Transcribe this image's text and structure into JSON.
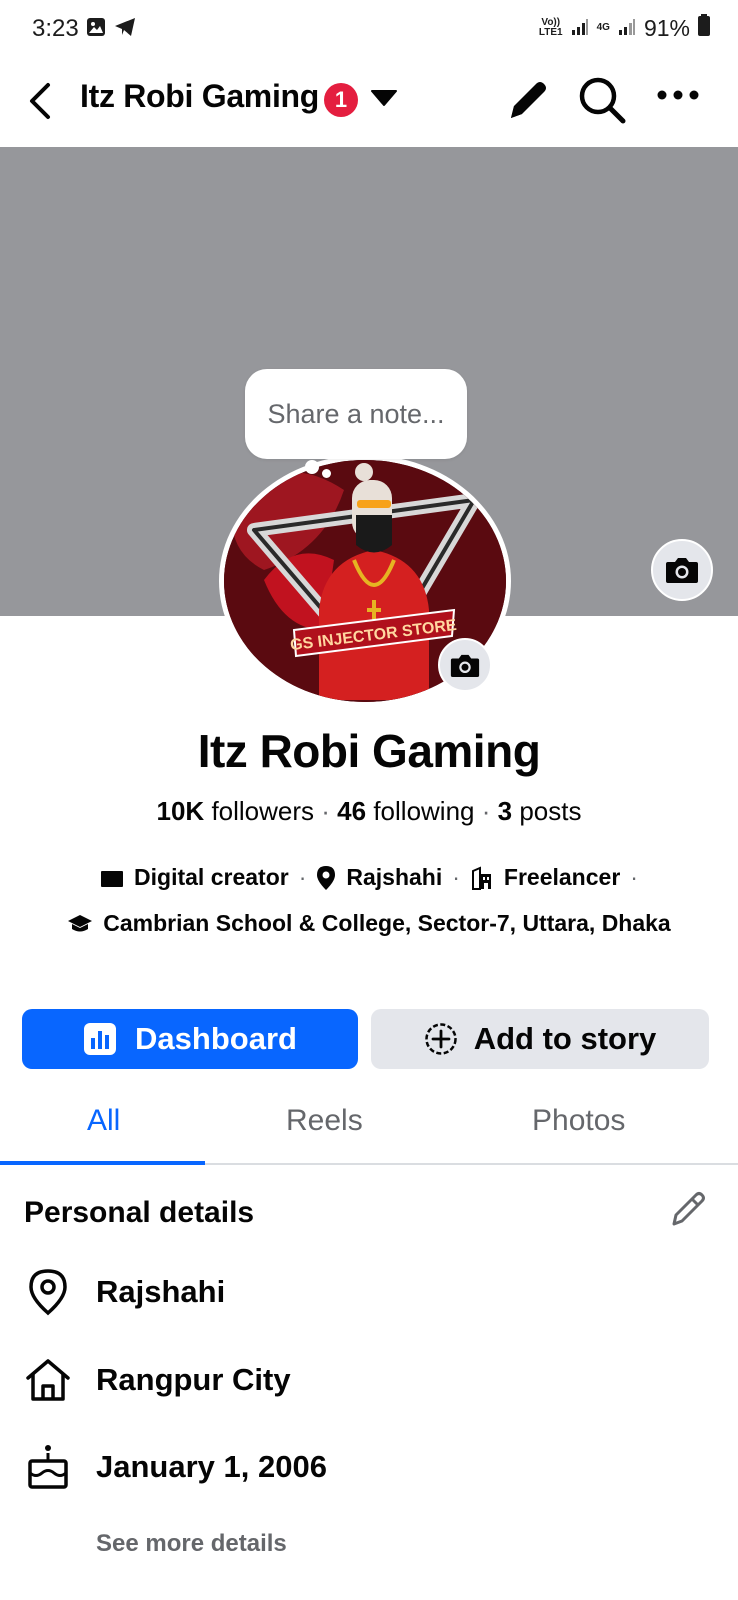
{
  "status_bar": {
    "time": "3:23",
    "net1_top": "Vo))",
    "net1_bottom": "LTE1",
    "net2": "4G",
    "battery": "91%"
  },
  "nav": {
    "title": "Itz Robi Gaming",
    "badge": "1"
  },
  "note": {
    "placeholder": "Share a note..."
  },
  "avatar": {
    "banner_text": "GS INJECTOR STORE"
  },
  "profile": {
    "name": "Itz Robi Gaming",
    "followers_count": "10K",
    "followers_label": "followers",
    "following_count": "46",
    "following_label": "following",
    "posts_count": "3",
    "posts_label": "posts",
    "separator": "·"
  },
  "intro": {
    "category": "Digital creator",
    "location": "Rajshahi",
    "work": "Freelancer",
    "education": "Cambrian School & College, Sector-7, Uttara, Dhaka"
  },
  "actions": {
    "dashboard": "Dashboard",
    "add_story": "Add to story"
  },
  "tabs": [
    {
      "label": "All",
      "active": true
    },
    {
      "label": "Reels",
      "active": false
    },
    {
      "label": "Photos",
      "active": false
    }
  ],
  "personal_details": {
    "title": "Personal details",
    "items": [
      {
        "icon": "location-pin-icon",
        "text": "Rajshahi"
      },
      {
        "icon": "home-icon",
        "text": "Rangpur City"
      },
      {
        "icon": "birthday-cake-icon",
        "text": "January 1, 2006"
      }
    ],
    "see_more": "See more details"
  },
  "colors": {
    "accent": "#0866ff",
    "badge": "#e41e3f",
    "cover": "#96979b",
    "secondary_text": "#65676b",
    "button_gray": "#e4e6eb"
  }
}
